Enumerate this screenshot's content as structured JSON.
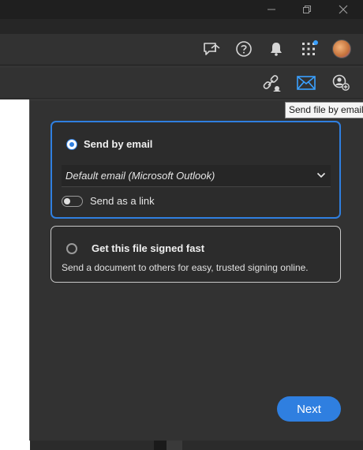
{
  "window": {
    "controls": [
      "minimize-icon",
      "restore-icon",
      "close-icon"
    ]
  },
  "toolbar": {
    "icons": [
      "share-review-icon",
      "help-icon",
      "bell-icon",
      "apps-grid-icon",
      "user-avatar"
    ]
  },
  "tools": {
    "icons": [
      "link-share-icon",
      "email-icon",
      "add-user-icon"
    ],
    "active": "email-icon"
  },
  "tooltip": {
    "text": "Send file by email"
  },
  "send_panel": {
    "email_option": {
      "label": "Send by email",
      "selected": true,
      "client_value": "Default email (Microsoft Outlook)",
      "link_toggle_label": "Send as a link",
      "link_toggle_on": false
    },
    "sign_option": {
      "label": "Get this file signed fast",
      "selected": false,
      "description": "Send a document to others for easy, trusted signing online."
    },
    "next_label": "Next"
  },
  "colors": {
    "accent": "#2f7fe0",
    "panel": "#323232",
    "titlebar": "#1f1f1f"
  }
}
